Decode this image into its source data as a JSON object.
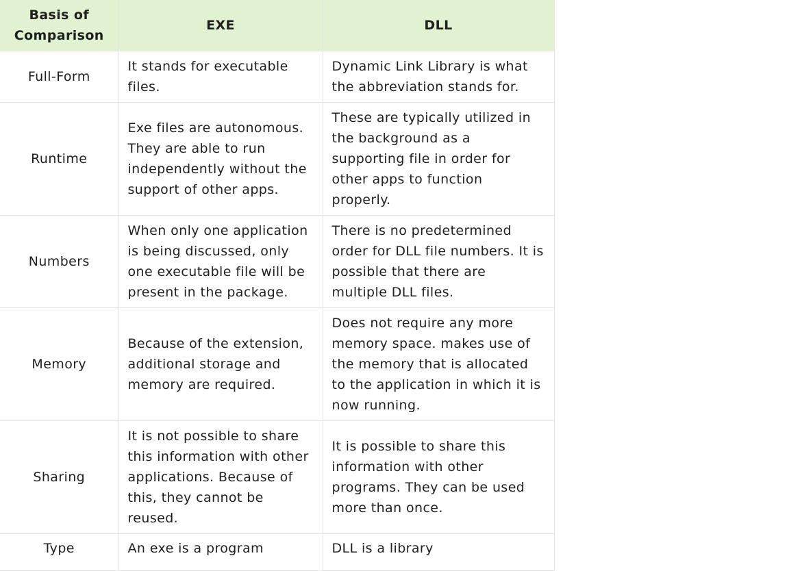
{
  "table": {
    "headers": [
      "Basis of Comparison",
      "EXE",
      "DLL"
    ],
    "rows": [
      {
        "basis": "Full-Form",
        "exe": "It stands for executable files.",
        "dll": "Dynamic Link Library is what the abbreviation stands for."
      },
      {
        "basis": "Runtime",
        "exe": "Exe files are autonomous. They are able to run independently without the support of other apps.",
        "dll": "These are typically utilized in the background as a supporting file in order for other apps to function properly."
      },
      {
        "basis": "Numbers",
        "exe": "When only one application is being discussed, only one executable file will be present in the package.",
        "dll": "There is no predetermined order for DLL file numbers. It is possible that there are multiple DLL files."
      },
      {
        "basis": "Memory",
        "exe": "Because of the extension, additional storage and memory are required.",
        "dll": "Does not require any more memory space. makes use of the memory that is allocated to the application in which it is now running."
      },
      {
        "basis": "Sharing",
        "exe": "It is not possible to share this information with other applications. Because of this, they cannot be reused.",
        "dll": "It is possible to share this information with other programs. They can be used more than once."
      },
      {
        "basis": "Type",
        "exe": "An exe is a program",
        "dll": "DLL is a library"
      }
    ]
  }
}
